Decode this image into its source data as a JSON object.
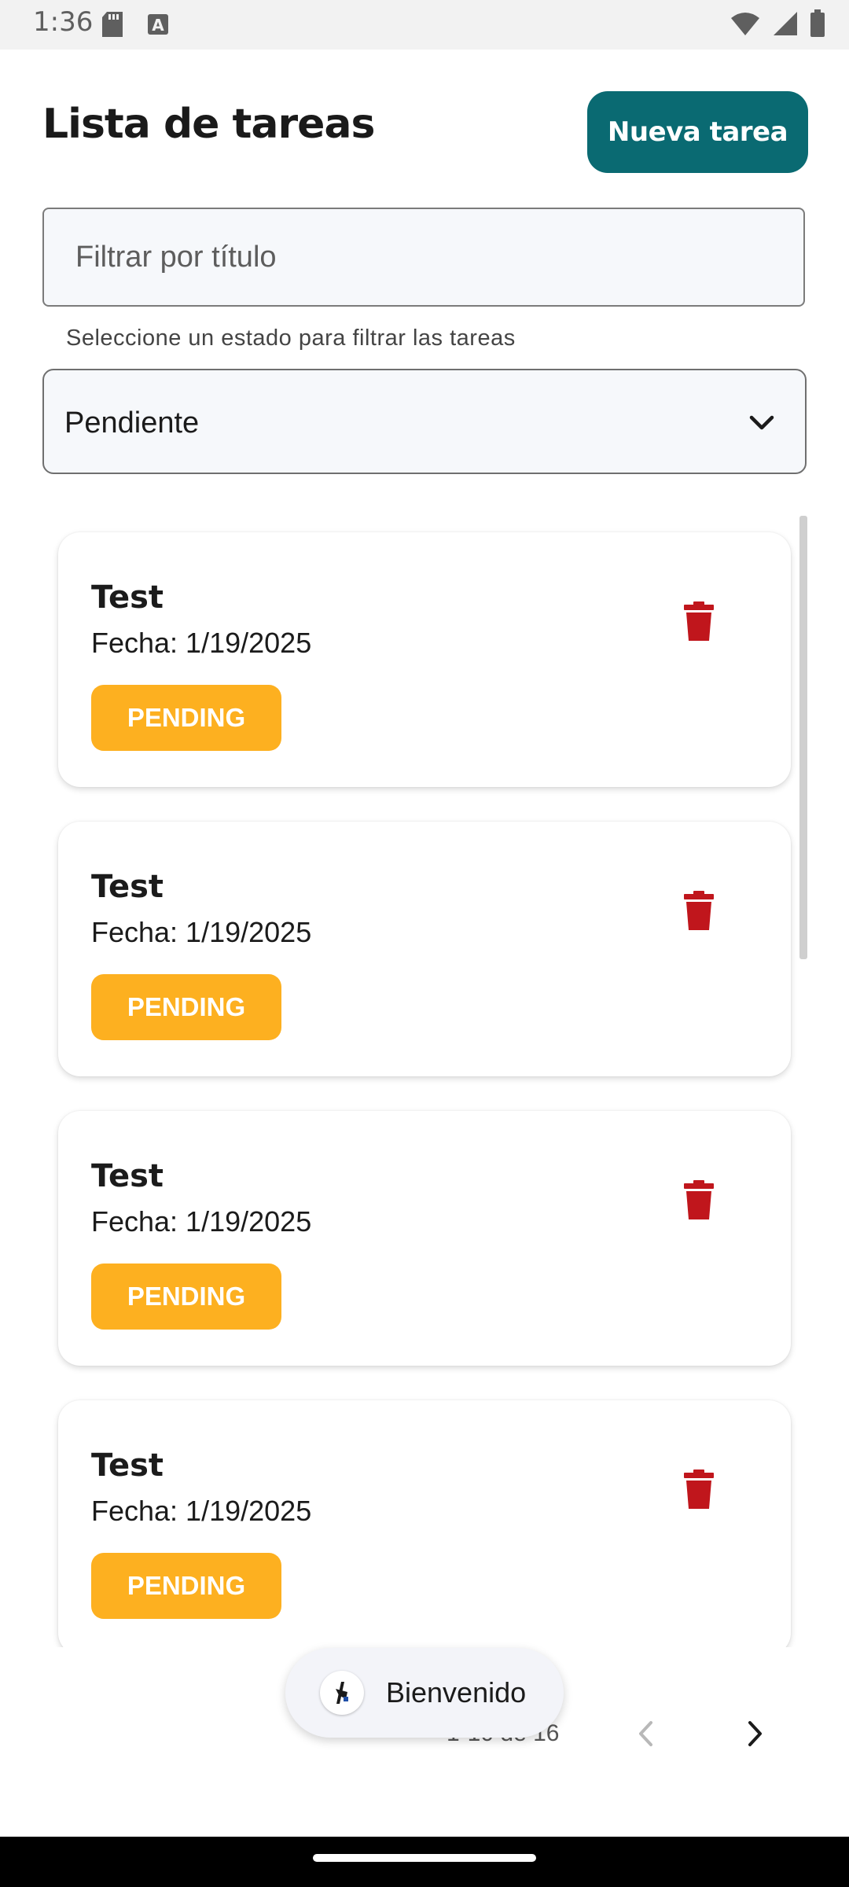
{
  "status_bar": {
    "time": "1:36"
  },
  "header": {
    "title": "Lista de tareas",
    "new_task_label": "Nueva tarea"
  },
  "filter": {
    "placeholder": "Filtrar por título",
    "helper": "Seleccione un estado para filtrar las tareas",
    "selected_state": "Pendiente"
  },
  "tasks": [
    {
      "title": "Test",
      "date": "Fecha: 1/19/2025",
      "status": "PENDING"
    },
    {
      "title": "Test",
      "date": "Fecha: 1/19/2025",
      "status": "PENDING"
    },
    {
      "title": "Test",
      "date": "Fecha: 1/19/2025",
      "status": "PENDING"
    },
    {
      "title": "Test",
      "date": "Fecha: 1/19/2025",
      "status": "PENDING"
    }
  ],
  "pagination": {
    "range": "1-10 de 16"
  },
  "snackbar": {
    "message": "Bienvenido"
  },
  "colors": {
    "accent": "#0a6a72",
    "pending": "#fdb020",
    "delete": "#c0161c"
  }
}
